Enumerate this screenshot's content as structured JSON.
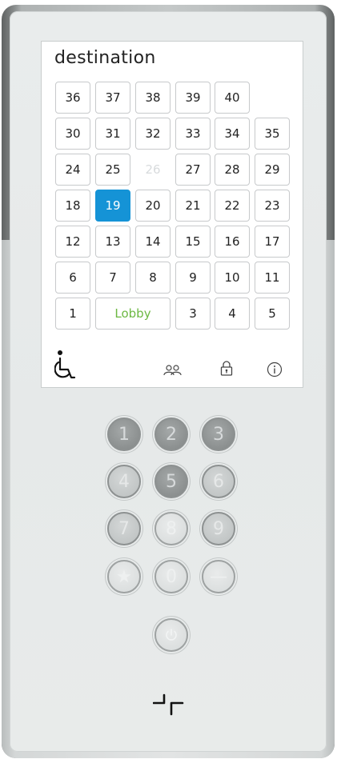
{
  "screen": {
    "title": "destination",
    "floors": [
      {
        "label": "36",
        "state": "normal"
      },
      {
        "label": "37",
        "state": "normal"
      },
      {
        "label": "38",
        "state": "normal"
      },
      {
        "label": "39",
        "state": "normal"
      },
      {
        "label": "40",
        "state": "normal"
      },
      {
        "label": "30",
        "state": "normal"
      },
      {
        "label": "31",
        "state": "normal"
      },
      {
        "label": "32",
        "state": "normal"
      },
      {
        "label": "33",
        "state": "normal"
      },
      {
        "label": "34",
        "state": "normal"
      },
      {
        "label": "35",
        "state": "normal"
      },
      {
        "label": "24",
        "state": "normal"
      },
      {
        "label": "25",
        "state": "normal"
      },
      {
        "label": "26",
        "state": "disabled"
      },
      {
        "label": "27",
        "state": "normal"
      },
      {
        "label": "28",
        "state": "normal"
      },
      {
        "label": "29",
        "state": "normal"
      },
      {
        "label": "18",
        "state": "normal"
      },
      {
        "label": "19",
        "state": "selected"
      },
      {
        "label": "20",
        "state": "normal"
      },
      {
        "label": "21",
        "state": "normal"
      },
      {
        "label": "22",
        "state": "normal"
      },
      {
        "label": "23",
        "state": "normal"
      },
      {
        "label": "12",
        "state": "normal"
      },
      {
        "label": "13",
        "state": "normal"
      },
      {
        "label": "14",
        "state": "normal"
      },
      {
        "label": "15",
        "state": "normal"
      },
      {
        "label": "16",
        "state": "normal"
      },
      {
        "label": "17",
        "state": "normal"
      },
      {
        "label": "6",
        "state": "normal"
      },
      {
        "label": "7",
        "state": "normal"
      },
      {
        "label": "8",
        "state": "normal"
      },
      {
        "label": "9",
        "state": "normal"
      },
      {
        "label": "10",
        "state": "normal"
      },
      {
        "label": "11",
        "state": "normal"
      },
      {
        "label": "1",
        "state": "normal"
      },
      {
        "label": "Lobby",
        "state": "lobby"
      },
      {
        "label": "3",
        "state": "normal"
      },
      {
        "label": "4",
        "state": "normal"
      },
      {
        "label": "5",
        "state": "normal"
      }
    ],
    "icons": [
      "wheelchair-icon",
      "group-icon",
      "lock-icon",
      "info-icon"
    ]
  },
  "keypad": {
    "keys": [
      "1",
      "2",
      "3",
      "4",
      "5",
      "6",
      "7",
      "8",
      "9",
      "★",
      "0",
      "—"
    ],
    "extra_key_icon": "power-icon"
  },
  "colors": {
    "selected": "#1593d6",
    "lobby_text": "#6cb842"
  }
}
